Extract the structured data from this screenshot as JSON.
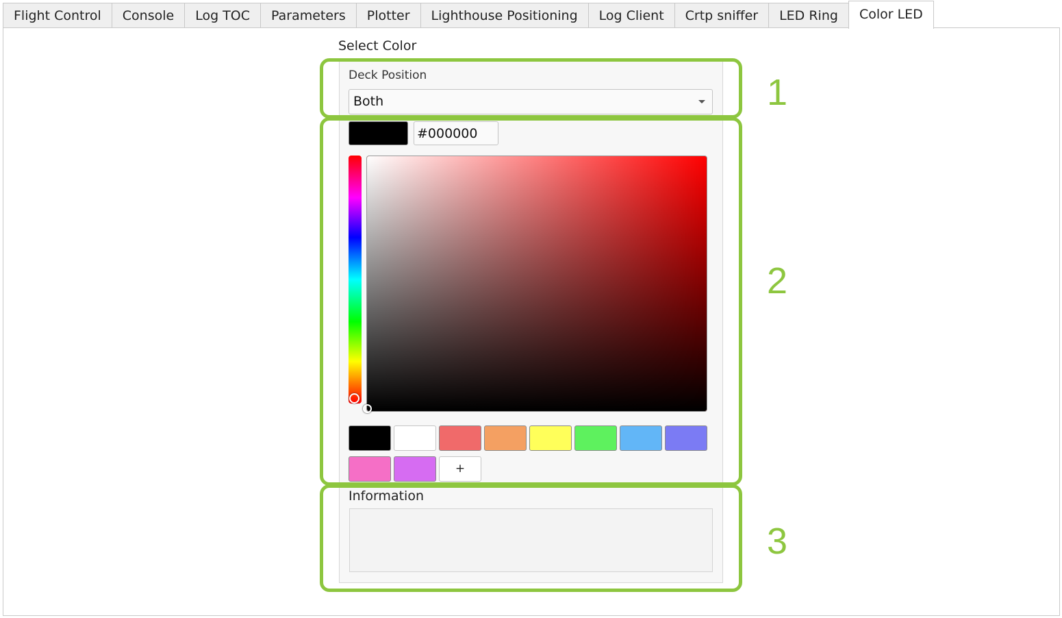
{
  "tabs": [
    {
      "label": "Flight Control"
    },
    {
      "label": "Console"
    },
    {
      "label": "Log TOC"
    },
    {
      "label": "Parameters"
    },
    {
      "label": "Plotter"
    },
    {
      "label": "Lighthouse Positioning"
    },
    {
      "label": "Log Client"
    },
    {
      "label": "Crtp sniffer"
    },
    {
      "label": "LED Ring"
    },
    {
      "label": "Color LED"
    }
  ],
  "active_tab": "Color LED",
  "select_color": {
    "group_title": "Select Color",
    "deck_position_label": "Deck Position",
    "deck_position_value": "Both",
    "current_color": "#000000",
    "hex_value": "#000000",
    "hue_base_color": "#ff0000",
    "preset_swatches": [
      {
        "color": "#000000"
      },
      {
        "color": "#ffffff"
      },
      {
        "color": "#f06a6a"
      },
      {
        "color": "#f4a062"
      },
      {
        "color": "#ffff5a"
      },
      {
        "color": "#5ef15e"
      },
      {
        "color": "#62b6f7"
      },
      {
        "color": "#7b7bf4"
      },
      {
        "color": "#f56fc6"
      },
      {
        "color": "#d66cf2"
      }
    ],
    "add_swatch_label": "+"
  },
  "information": {
    "title": "Information",
    "text": ""
  },
  "callouts": [
    {
      "number": "1"
    },
    {
      "number": "2"
    },
    {
      "number": "3"
    }
  ],
  "callout_color": "#8dc63f"
}
